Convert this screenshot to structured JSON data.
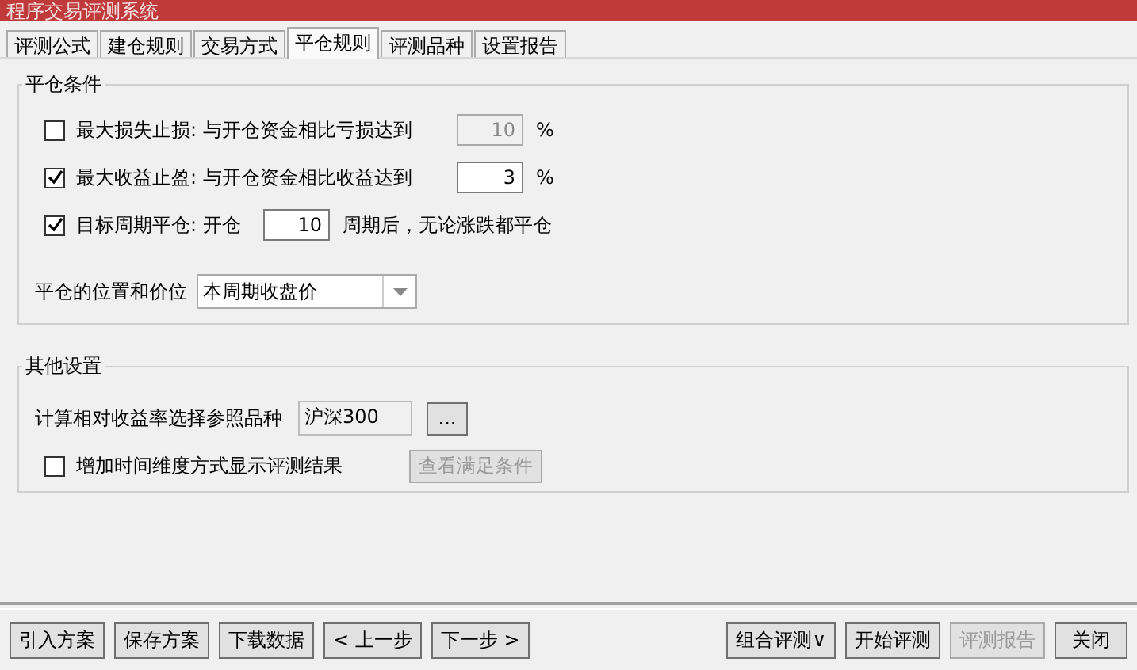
{
  "window": {
    "title": "程序交易评测系统"
  },
  "tabs": [
    {
      "label": "评测公式",
      "selected": false
    },
    {
      "label": "建仓规则",
      "selected": false
    },
    {
      "label": "交易方式",
      "selected": false
    },
    {
      "label": "平仓规则",
      "selected": true
    },
    {
      "label": "评测品种",
      "selected": false
    },
    {
      "label": "设置报告",
      "selected": false
    }
  ],
  "close_conditions": {
    "title": "平仓条件",
    "rules": [
      {
        "label": "最大损失止损: 与开仓资金相比亏损达到",
        "checked": false,
        "value": "10",
        "unit": "%",
        "kind": "percent"
      },
      {
        "label": "最大收益止盈: 与开仓资金相比收益达到",
        "checked": true,
        "value": "3",
        "unit": "%",
        "kind": "percent"
      },
      {
        "label": "目标周期平仓: 开仓",
        "checked": true,
        "value": "10",
        "unit": "周期后，无论涨跌都平仓",
        "kind": "period"
      }
    ],
    "position_label": "平仓的位置和价位",
    "position_value": "本周期收盘价"
  },
  "other_settings": {
    "title": "其他设置",
    "reference_label": "计算相对收益率选择参照品种",
    "reference_value": "沪深300",
    "browse_button": "...",
    "time_dimension": {
      "label": "增加时间维度方式显示评测结果",
      "checked": false
    },
    "view_button": {
      "label": "查看满足条件",
      "disabled": true
    }
  },
  "footer_left": [
    {
      "label": "引入方案",
      "disabled": false
    },
    {
      "label": "保存方案",
      "disabled": false
    },
    {
      "label": "下载数据",
      "disabled": false
    },
    {
      "label": "< 上一步",
      "disabled": false
    },
    {
      "label": "下一步 >",
      "disabled": false
    }
  ],
  "footer_right": [
    {
      "label": "组合评测∨",
      "disabled": false
    },
    {
      "label": "开始评测",
      "disabled": false
    },
    {
      "label": "评测报告",
      "disabled": true
    },
    {
      "label": "关闭",
      "disabled": false
    }
  ]
}
